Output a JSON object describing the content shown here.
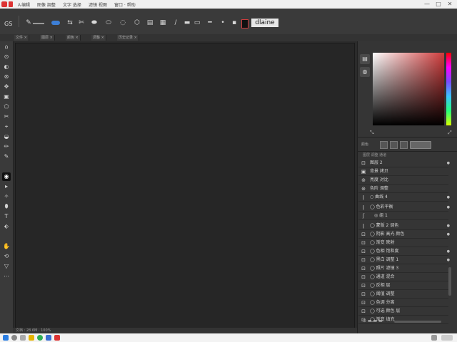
{
  "titlebar": {
    "menus": [
      "Ａ编辑",
      "图像 調整",
      "文字 选择",
      "滤镜 视图",
      "窗口 · 帮助"
    ],
    "controls": [
      "—",
      "□",
      "✕"
    ]
  },
  "options": {
    "preset_label": "GS",
    "font_preview": "dlaine",
    "icons": [
      "✎",
      "⇆",
      "✄",
      "⬬",
      "⬭",
      "◌",
      "⬡",
      "▤",
      "▦",
      "∕",
      "▬",
      "▭",
      "━",
      "•",
      "▪"
    ]
  },
  "doc_tabs": [
    "文件 ×",
    "图层 ×",
    "颜色 ×",
    "调整 ×",
    "历史记录 ×"
  ],
  "left_tools": [
    "⌂",
    "⊙",
    "◐",
    "⊛",
    "✥",
    "▣",
    "⬠",
    "✂",
    "⌖",
    "◒",
    "✏",
    "✎",
    "◉",
    "▸",
    "✧",
    "⬮",
    "Ƭ",
    "⬖",
    "✋",
    "⟲",
    "▽",
    "⋯"
  ],
  "right_panel": {
    "side_icons": [
      "▤",
      "◍"
    ],
    "swatch_label": "颜色",
    "layers_header": "图层 调整 通道",
    "layers": [
      {
        "icon": "⊡",
        "label": "图层 2"
      },
      {
        "icon": "▣",
        "label": "背景 拷贝"
      },
      {
        "icon": "⊚",
        "label": "亮度 对比"
      },
      {
        "icon": "⊛",
        "label": "色阶 调整"
      },
      {
        "icon": "ǀ",
        "label": "○ 曲线 4"
      },
      {
        "icon": "ǀ",
        "label": "◯ 色彩平衡"
      },
      {
        "icon": "ʃ",
        "label": "◎ 组 1"
      },
      {
        "icon": "ǀ",
        "label": "◯ 蒙版 2 调色"
      },
      {
        "icon": "⊡",
        "label": "◯ 阴影 高光 颜色"
      },
      {
        "icon": "⊡",
        "label": "◯ 渐变 映射"
      },
      {
        "icon": "⊡",
        "label": "◯ 色相 饱和度"
      },
      {
        "icon": "⊡",
        "label": "◯ 黑白 调整 1"
      },
      {
        "icon": "⊡",
        "label": "◯ 照片 滤镜 3"
      },
      {
        "icon": "⊡",
        "label": "◯ 通道 混合"
      },
      {
        "icon": "⊡",
        "label": "◯ 反相 层"
      },
      {
        "icon": "⊡",
        "label": "◯ 阈值 调整"
      },
      {
        "icon": "⊡",
        "label": "◯ 色调 分离"
      },
      {
        "icon": "⊡",
        "label": "◯ 可选 颜色 层"
      },
      {
        "icon": "⊡",
        "label": "◯ 渐变 填充"
      },
      {
        "icon": "⊡",
        "label": "◯ 背景 图层"
      }
    ],
    "bottom_icons": "⊙ ▬ ▬ ▬"
  },
  "status": "文档 : 28.6M  ·  100%",
  "colors": {
    "accent": "#cf3c3c",
    "panel": "#353535",
    "canvas": "#262626"
  }
}
